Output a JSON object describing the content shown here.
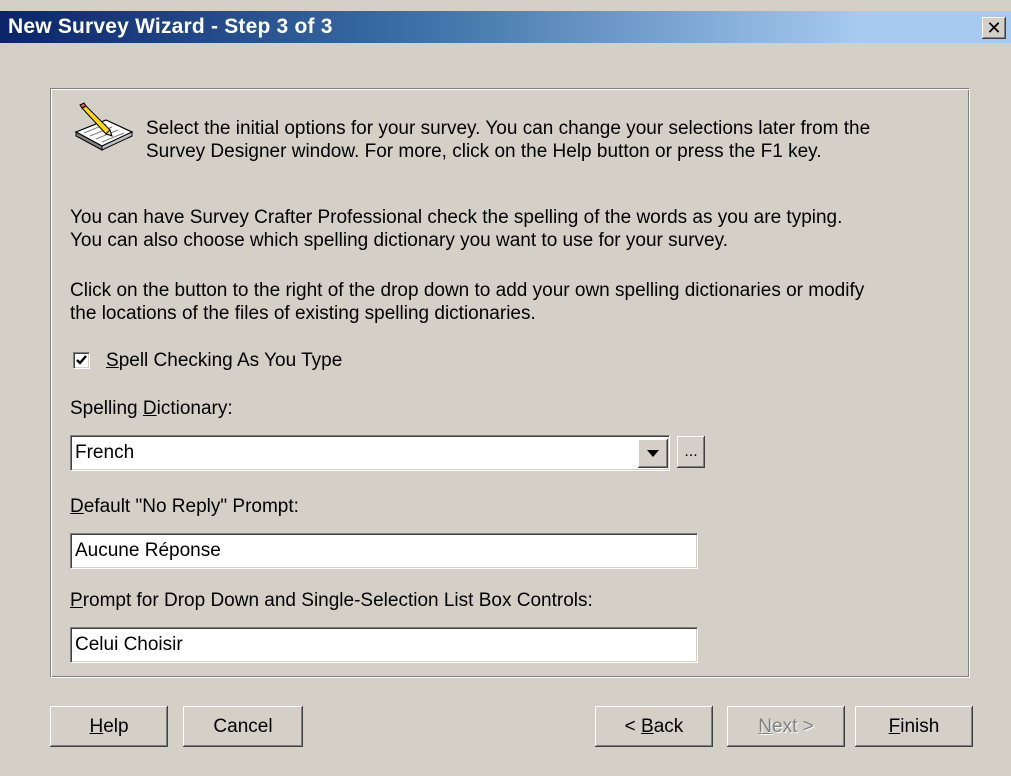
{
  "window": {
    "title": "New Survey Wizard - Step 3 of 3",
    "close_glyph": "✕"
  },
  "intro": {
    "line1": "Select the initial options for your survey. You can change your selections later from the",
    "line2": "Survey Designer window. For more, click on the Help button or press the F1 key."
  },
  "spelling_info": {
    "para1_line1": "You can have Survey Crafter Professional check the spelling of the words as you are typing.",
    "para1_line2": "You can also choose which spelling dictionary you want to use for your survey.",
    "para2_line1": "Click on the button to the right of the drop down to add your own spelling dictionaries or modify",
    "para2_line2": "the locations of the files of existing spelling dictionaries."
  },
  "spell_check": {
    "checked": true,
    "label_access": "S",
    "label_rest": "pell Checking As You Type"
  },
  "dictionary": {
    "label_pre": "Spelling ",
    "label_access": "D",
    "label_rest": "ictionary:",
    "selected": "French",
    "browse_label": "..."
  },
  "no_reply": {
    "label_access": "D",
    "label_rest": "efault \"No Reply\" Prompt:",
    "value": "Aucune Réponse"
  },
  "drop_prompt": {
    "label_access": "P",
    "label_rest": "rompt for Drop Down and Single-Selection List Box Controls:",
    "value": "Celui Choisir"
  },
  "buttons": {
    "help_access": "H",
    "help_rest": "elp",
    "cancel": "Cancel",
    "back_pre": "< ",
    "back_access": "B",
    "back_rest": "ack",
    "next_access": "N",
    "next_rest": "ext >",
    "next_enabled": false,
    "finish_access": "F",
    "finish_rest": "inish"
  },
  "colors": {
    "dialog_bg": "#d4d0c8",
    "titlebar_start": "#0a246a",
    "titlebar_end": "#a6caf0",
    "disabled_text": "#808080"
  },
  "icons": {
    "wizard": "notepad-pencil-icon",
    "close": "close-icon",
    "combo_arrow": "chevron-down-icon",
    "checkmark": "checkmark-icon"
  }
}
